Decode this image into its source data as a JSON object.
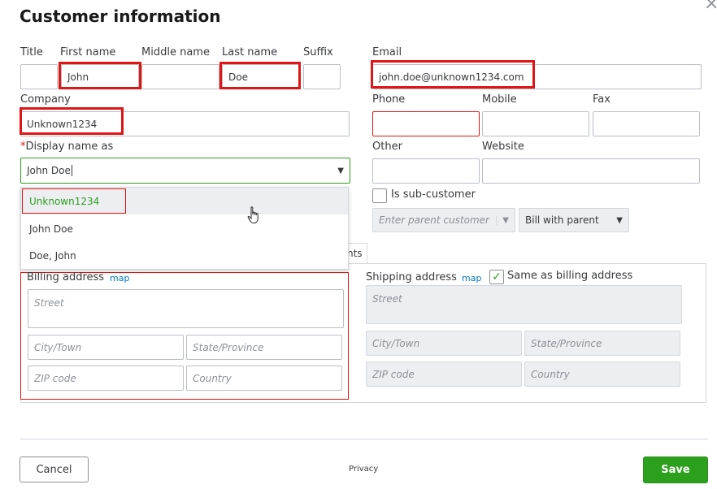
{
  "dialog": {
    "title": "Customer information",
    "close_glyph": "×"
  },
  "labels": {
    "title": "Title",
    "first_name": "First name",
    "middle_name": "Middle name",
    "last_name": "Last name",
    "suffix": "Suffix",
    "email": "Email",
    "company": "Company",
    "phone": "Phone",
    "mobile": "Mobile",
    "fax": "Fax",
    "display_name_required": "*",
    "display_name": "Display name as",
    "other": "Other",
    "website": "Website",
    "sub_customer": "Is sub-customer"
  },
  "values": {
    "title": "",
    "first_name": "John",
    "middle_name": "",
    "last_name": "Doe",
    "suffix": "",
    "email": "john.doe@unknown1234.com",
    "company": "Unknown1234",
    "phone": "",
    "mobile": "",
    "fax": "",
    "display_name": "John  Doe",
    "other": "",
    "website": ""
  },
  "display_dropdown": {
    "options": [
      "Unknown1234",
      "John Doe",
      "Doe, John"
    ],
    "highlighted": 0
  },
  "sub_customer": {
    "checked": false,
    "parent_placeholder": "Enter parent customer",
    "billing_option": "Bill with parent"
  },
  "tab_fragment": "nts",
  "billing": {
    "title": "Billing address",
    "map_link": "map",
    "street_ph": "Street",
    "city_ph": "City/Town",
    "state_ph": "State/Province",
    "zip_ph": "ZIP code",
    "country_ph": "Country"
  },
  "shipping": {
    "title": "Shipping address",
    "map_link": "map",
    "same_as_billing": "Same as billing address",
    "same_checked": true,
    "street_ph": "Street",
    "city_ph": "City/Town",
    "state_ph": "State/Province",
    "zip_ph": "ZIP code",
    "country_ph": "Country"
  },
  "footer": {
    "cancel": "Cancel",
    "privacy": "Privacy",
    "save": "Save"
  },
  "colors": {
    "accent": "#2ca01c",
    "highlight": "#e01515",
    "link": "#0077c5"
  }
}
